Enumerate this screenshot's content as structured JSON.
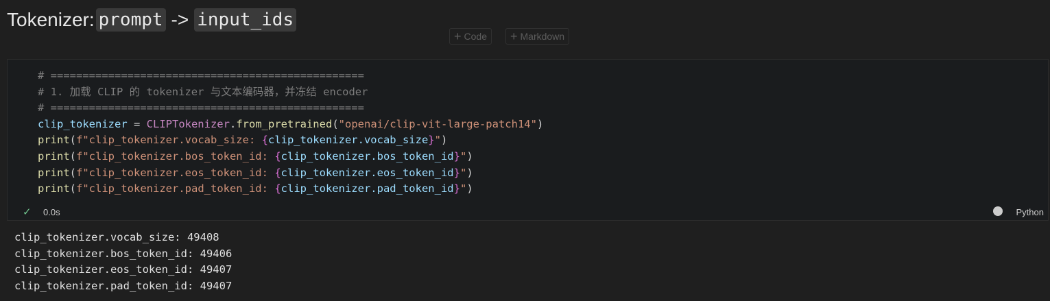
{
  "heading": {
    "prefix": "Tokenizer:",
    "code1": "prompt",
    "arrow": "->",
    "code2": "input_ids"
  },
  "toolbar": {
    "code_label": "Code",
    "markdown_label": "Markdown"
  },
  "cell": {
    "lines": [
      [
        {
          "t": "comment",
          "v": "# ================================================="
        }
      ],
      [
        {
          "t": "comment",
          "v": "# 1. 加载 CLIP 的 tokenizer 与文本编码器，并冻结 encoder"
        }
      ],
      [
        {
          "t": "comment",
          "v": "# ================================================="
        }
      ],
      [
        {
          "t": "var",
          "v": "clip_tokenizer"
        },
        {
          "t": "op",
          "v": " = "
        },
        {
          "t": "cls",
          "v": "CLIPTokenizer"
        },
        {
          "t": "op",
          "v": "."
        },
        {
          "t": "fn",
          "v": "from_pretrained"
        },
        {
          "t": "paren",
          "v": "("
        },
        {
          "t": "str",
          "v": "\"openai/clip-vit-large-patch14\""
        },
        {
          "t": "paren",
          "v": ")"
        }
      ],
      [
        {
          "t": "fn",
          "v": "print"
        },
        {
          "t": "paren",
          "v": "("
        },
        {
          "t": "str",
          "v": "f\"clip_tokenizer.vocab_size: "
        },
        {
          "t": "brace",
          "v": "{"
        },
        {
          "t": "var",
          "v": "clip_tokenizer.vocab_size"
        },
        {
          "t": "brace",
          "v": "}"
        },
        {
          "t": "str",
          "v": "\""
        },
        {
          "t": "paren",
          "v": ")"
        }
      ],
      [
        {
          "t": "fn",
          "v": "print"
        },
        {
          "t": "paren",
          "v": "("
        },
        {
          "t": "str",
          "v": "f\"clip_tokenizer.bos_token_id: "
        },
        {
          "t": "brace",
          "v": "{"
        },
        {
          "t": "var",
          "v": "clip_tokenizer.bos_token_id"
        },
        {
          "t": "brace",
          "v": "}"
        },
        {
          "t": "str",
          "v": "\""
        },
        {
          "t": "paren",
          "v": ")"
        }
      ],
      [
        {
          "t": "fn",
          "v": "print"
        },
        {
          "t": "paren",
          "v": "("
        },
        {
          "t": "str",
          "v": "f\"clip_tokenizer.eos_token_id: "
        },
        {
          "t": "brace",
          "v": "{"
        },
        {
          "t": "var",
          "v": "clip_tokenizer.eos_token_id"
        },
        {
          "t": "brace",
          "v": "}"
        },
        {
          "t": "str",
          "v": "\""
        },
        {
          "t": "paren",
          "v": ")"
        }
      ],
      [
        {
          "t": "fn",
          "v": "print"
        },
        {
          "t": "paren",
          "v": "("
        },
        {
          "t": "str",
          "v": "f\"clip_tokenizer.pad_token_id: "
        },
        {
          "t": "brace",
          "v": "{"
        },
        {
          "t": "var",
          "v": "clip_tokenizer.pad_token_id"
        },
        {
          "t": "brace",
          "v": "}"
        },
        {
          "t": "str",
          "v": "\""
        },
        {
          "t": "paren",
          "v": ")"
        }
      ]
    ],
    "status": {
      "check_icon": "check-icon",
      "time": "0.0s",
      "kernel_icon": "kernel-icon",
      "kernel": "Python"
    }
  },
  "output": {
    "lines": [
      "clip_tokenizer.vocab_size: 49408",
      "clip_tokenizer.bos_token_id: 49406",
      "clip_tokenizer.eos_token_id: 49407",
      "clip_tokenizer.pad_token_id: 49407"
    ]
  },
  "colors": {
    "background": "#1f1f1f",
    "cell_background": "#1a1c1e",
    "success": "#73c991"
  }
}
